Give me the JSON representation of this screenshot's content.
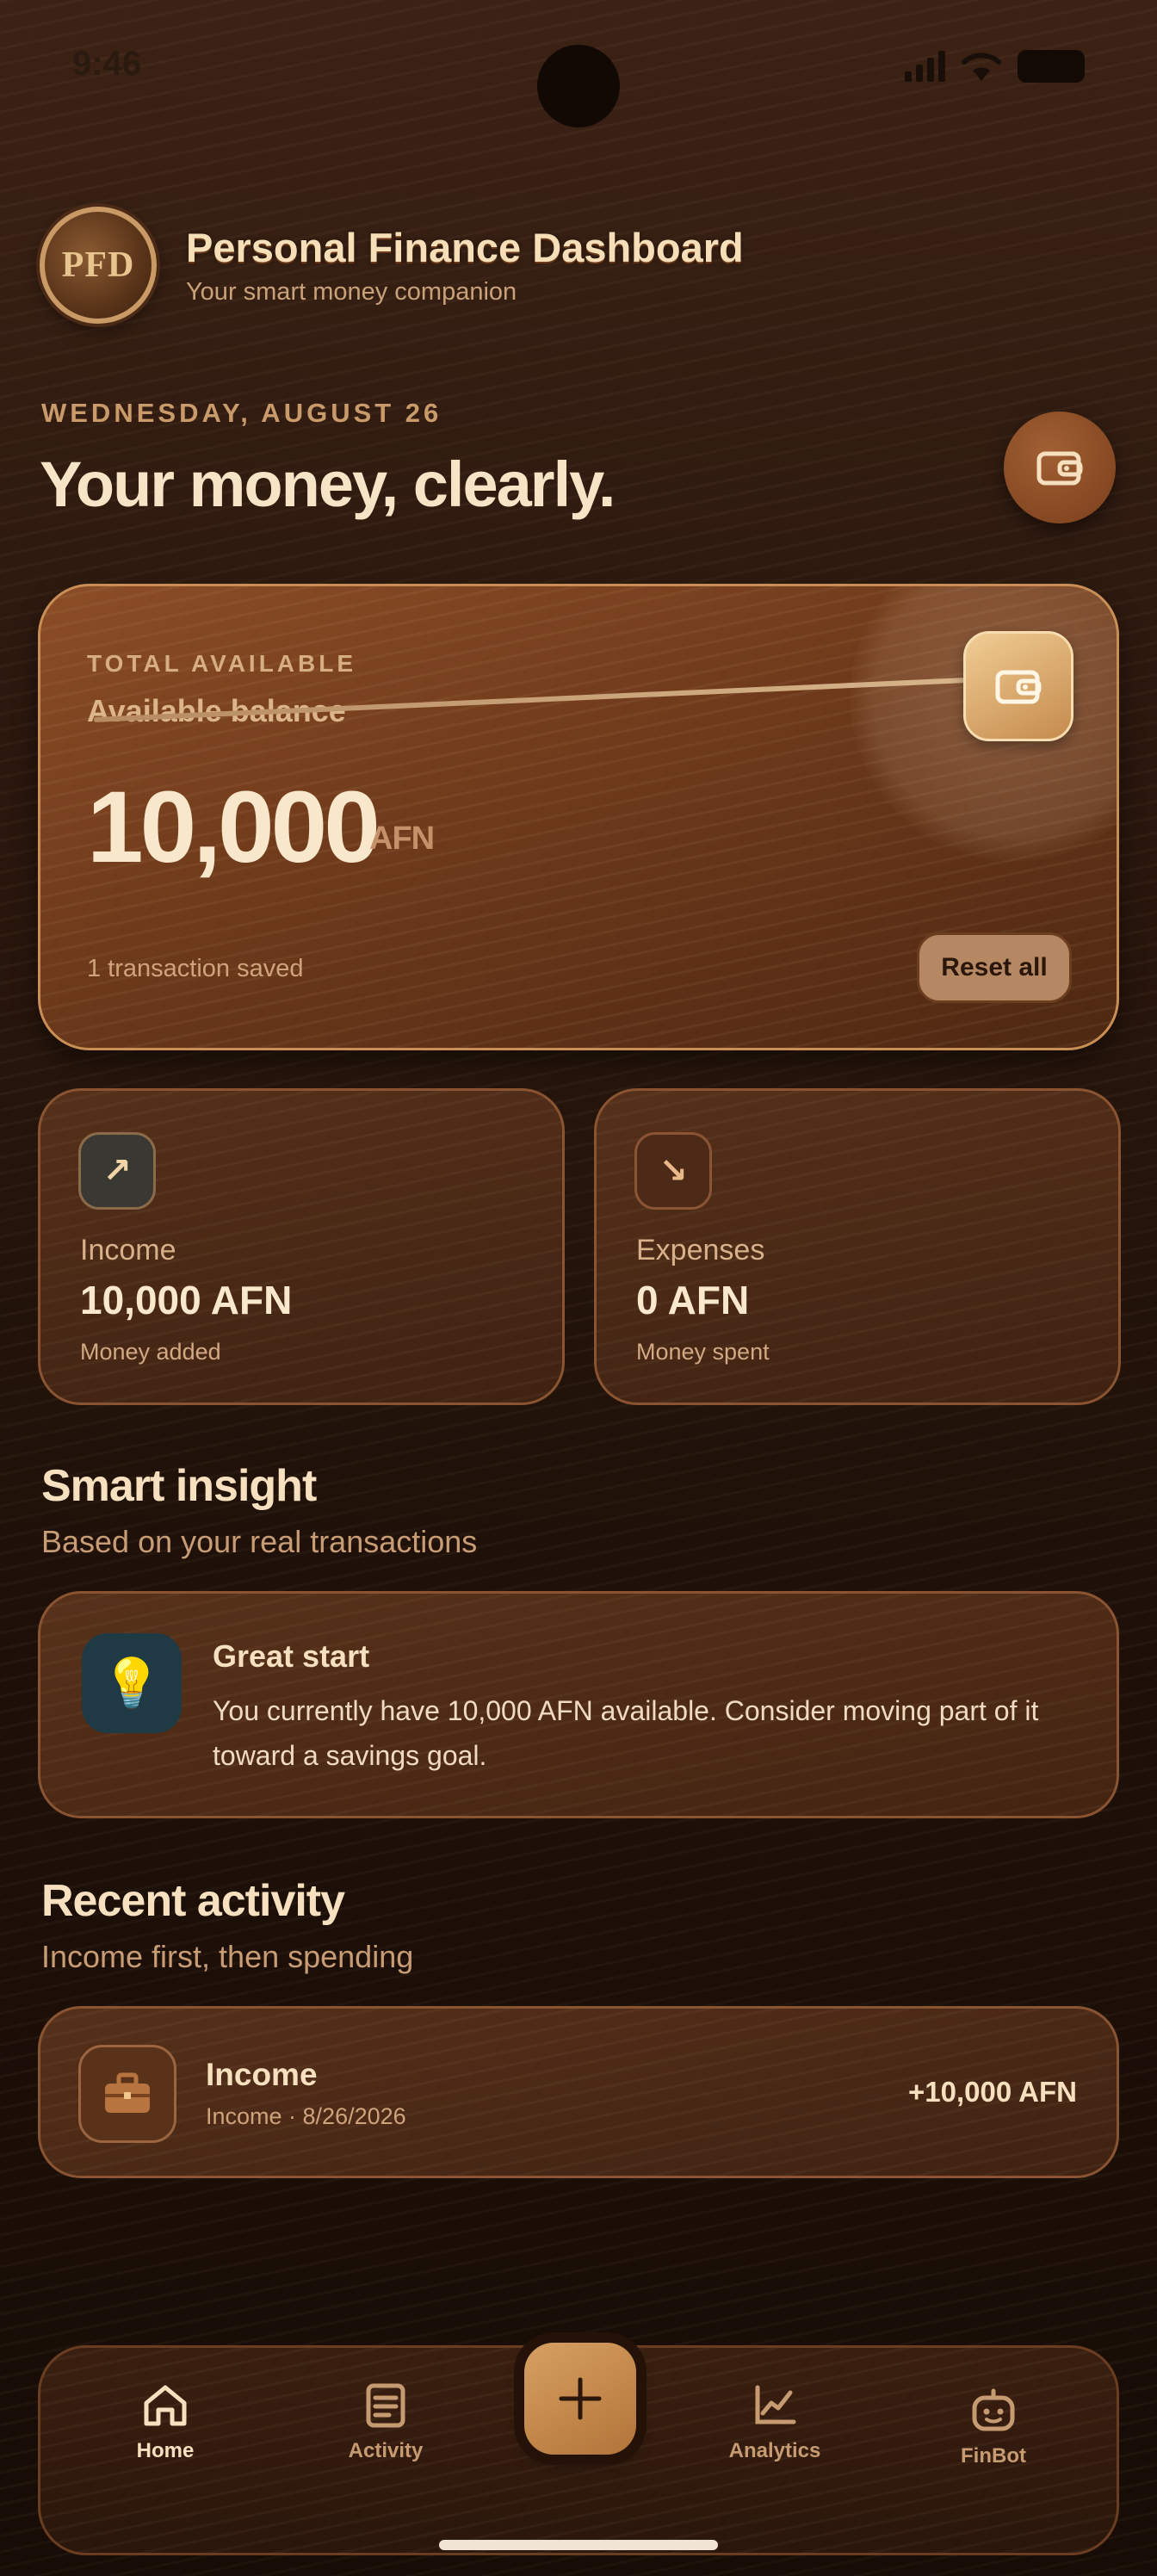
{
  "status_bar": {
    "time": "9:46"
  },
  "header": {
    "logo_text": "PFD",
    "title": "Personal Finance Dashboard",
    "subtitle": "Your smart money companion"
  },
  "hero": {
    "date": "WEDNESDAY, AUGUST 26",
    "headline": "Your money, clearly."
  },
  "balance": {
    "label": "TOTAL AVAILABLE",
    "sublabel": "Available balance",
    "amount": "10,000",
    "currency": "AFN",
    "transactions_text": "1 transaction saved",
    "reset_label": "Reset all"
  },
  "stats": {
    "income": {
      "icon": "↗",
      "label": "Income",
      "value": "10,000 AFN",
      "caption": "Money added"
    },
    "expenses": {
      "icon": "↘",
      "label": "Expenses",
      "value": "0 AFN",
      "caption": "Money spent"
    }
  },
  "insight": {
    "section_title": "Smart insight",
    "section_subtitle": "Based on your real transactions",
    "icon": "💡",
    "title": "Great start",
    "body": "You currently have 10,000 AFN available. Consider moving part of it toward a savings goal."
  },
  "activity": {
    "section_title": "Recent activity",
    "section_subtitle": "Income first, then spending",
    "items": [
      {
        "title": "Income",
        "meta": "Income · 8/26/2026",
        "amount": "+10,000 AFN"
      }
    ]
  },
  "nav": {
    "home": "Home",
    "activity": "Activity",
    "analytics": "Analytics",
    "finbot": "FinBot"
  },
  "colors": {
    "accent": "#c98e55",
    "background": "#1d0f08",
    "text": "#f6e0bf"
  }
}
